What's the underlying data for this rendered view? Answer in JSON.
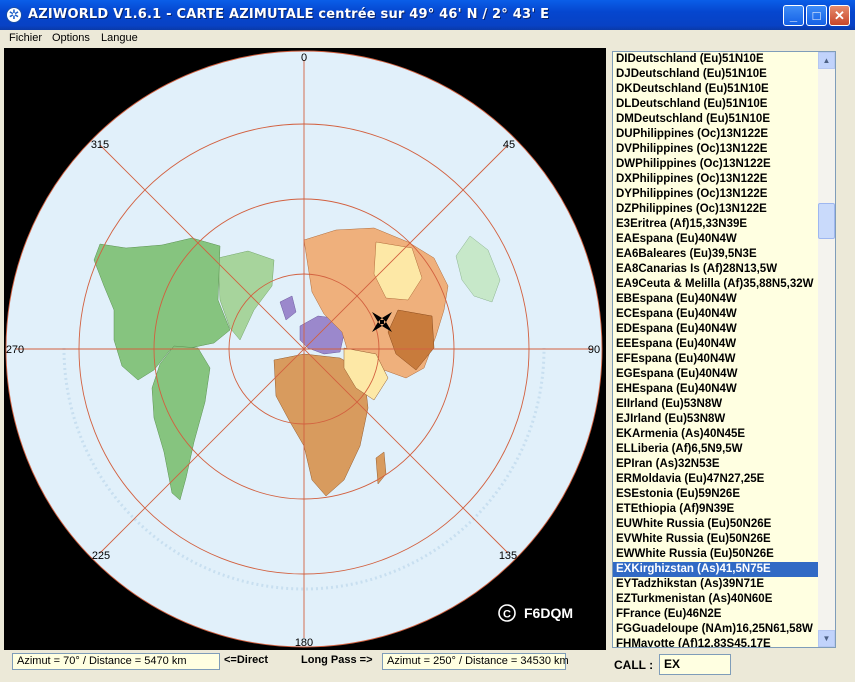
{
  "window": {
    "title": "AZIWORLD V1.6.1 - CARTE AZIMUTALE centrée sur 49° 46' N / 2° 43' E",
    "minimize": "_",
    "maximize": "□",
    "close": "✕"
  },
  "menu": [
    "Fichier",
    "Options",
    "Langue"
  ],
  "map": {
    "bearing_labels": {
      "n": "0",
      "ne": "45",
      "e": "90",
      "se": "135",
      "s": "180",
      "sw": "225",
      "w": "270",
      "nw": "315"
    },
    "copyright_symbol": "C",
    "copyright_callsign": "F6DQM",
    "colors": {
      "ocean": "#dfeff9",
      "grid": "#d2603f",
      "background": "#000000",
      "target_marker": "#000000"
    }
  },
  "prefix_list": {
    "items": [
      "DIDeutschland (Eu)51N10E",
      "DJDeutschland (Eu)51N10E",
      "DKDeutschland (Eu)51N10E",
      "DLDeutschland (Eu)51N10E",
      "DMDeutschland (Eu)51N10E",
      "DUPhilippines (Oc)13N122E",
      "DVPhilippines (Oc)13N122E",
      "DWPhilippines (Oc)13N122E",
      "DXPhilippines (Oc)13N122E",
      "DYPhilippines (Oc)13N122E",
      "DZPhilippines (Oc)13N122E",
      "E3Eritrea (Af)15,33N39E",
      "EAEspana (Eu)40N4W",
      "EA6Baleares (Eu)39,5N3E",
      "EA8Canarias Is (Af)28N13,5W",
      "EA9Ceuta & Melilla (Af)35,88N5,32W",
      "EBEspana (Eu)40N4W",
      "ECEspana (Eu)40N4W",
      "EDEspana (Eu)40N4W",
      "EEEspana (Eu)40N4W",
      "EFEspana (Eu)40N4W",
      "EGEspana (Eu)40N4W",
      "EHEspana (Eu)40N4W",
      "EIIrland (Eu)53N8W",
      "EJIrland (Eu)53N8W",
      "EKArmenia (As)40N45E",
      "ELLiberia (Af)6,5N9,5W",
      "EPIran (As)32N53E",
      "ERMoldavia (Eu)47N27,25E",
      "ESEstonia (Eu)59N26E",
      "ETEthiopia (Af)9N39E",
      "EUWhite Russia (Eu)50N26E",
      "EVWhite Russia (Eu)50N26E",
      "EWWhite Russia (Eu)50N26E",
      "EXKirghizstan (As)41,5N75E",
      "EYTadzhikstan (As)39N71E",
      "EZTurkmenistan (As)40N60E",
      "FFrance (Eu)46N2E",
      "FGGuadeloupe (NAm)16,25N61,58W",
      "FHMayotte (Af)12.83S45.17E"
    ],
    "selected_index": 34,
    "scroll_up": "▲",
    "scroll_down": "▼"
  },
  "status": {
    "direct_value": "Azimut = 70° /  Distance = 5470 km",
    "direct_label": "<=Direct",
    "long_pass_label": "Long Pass =>",
    "long_pass_value": "Azimut = 250° /  Distance = 34530 km",
    "call_label": "CALL :",
    "call_value": "EX"
  }
}
